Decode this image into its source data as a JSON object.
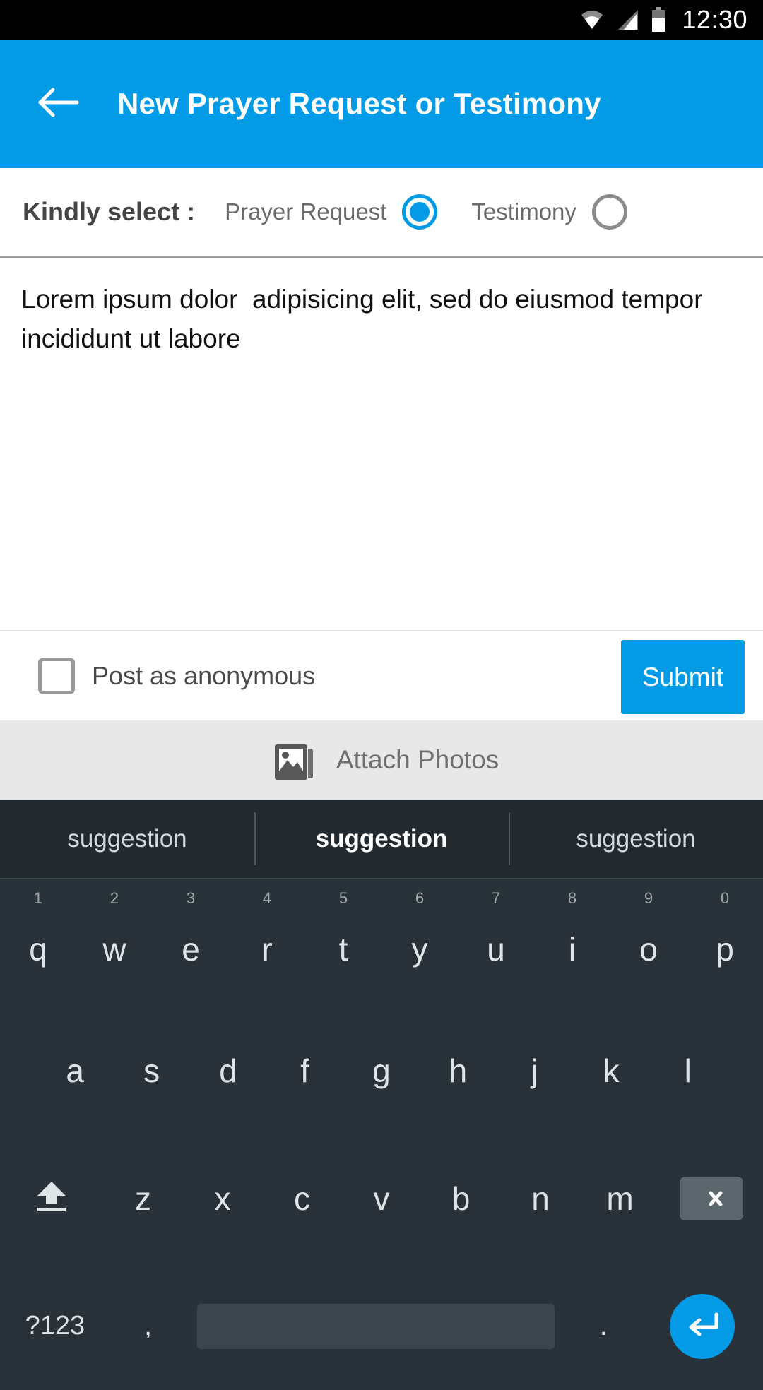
{
  "status_bar": {
    "time": "12:30",
    "icons": [
      "wifi-icon",
      "cell-signal-icon",
      "battery-icon"
    ]
  },
  "app_bar": {
    "back_icon": "arrow-left-icon",
    "title": "New Prayer Request or Testimony",
    "background_color": "#039BE5"
  },
  "select_row": {
    "label": "Kindly select :",
    "options": [
      {
        "label": "Prayer Request",
        "selected": true
      },
      {
        "label": "Testimony",
        "selected": false
      }
    ]
  },
  "compose": {
    "text": "Lorem ipsum dolor  adipisicing elit, sed do eiusmod tempor incididunt ut labore",
    "placeholder": "Lorem ipsum dolor  adipisicing elit, sed do eiusmod tempor incididunt ut labore"
  },
  "action_row": {
    "anonymous_label": "Post as anonymous",
    "anonymous_checked": false,
    "submit_label": "Submit",
    "submit_color": "#039BE5"
  },
  "attach": {
    "icon": "photo-stack-icon",
    "label": "Attach Photos",
    "background_color": "#e8e8e8"
  },
  "keyboard": {
    "suggestions": [
      {
        "text": "suggestion",
        "active": false
      },
      {
        "text": "suggestion",
        "active": true
      },
      {
        "text": "suggestion",
        "active": false
      }
    ],
    "row1": [
      {
        "letter": "q",
        "num": "1"
      },
      {
        "letter": "w",
        "num": "2"
      },
      {
        "letter": "e",
        "num": "3"
      },
      {
        "letter": "r",
        "num": "4"
      },
      {
        "letter": "t",
        "num": "5"
      },
      {
        "letter": "y",
        "num": "6"
      },
      {
        "letter": "u",
        "num": "7"
      },
      {
        "letter": "i",
        "num": "8"
      },
      {
        "letter": "o",
        "num": "9"
      },
      {
        "letter": "p",
        "num": "0"
      }
    ],
    "row2": [
      "a",
      "s",
      "d",
      "f",
      "g",
      "h",
      "j",
      "k",
      "l"
    ],
    "row3": {
      "shift_icon": "shift-up-icon",
      "letters": [
        "z",
        "x",
        "c",
        "v",
        "b",
        "n",
        "m"
      ],
      "backspace_icon": "backspace-icon"
    },
    "row4": {
      "symbols_label": "?123",
      "comma_label": ",",
      "space_label": "",
      "period_label": ".",
      "enter_icon": "enter-return-icon"
    },
    "background_color": "#283238",
    "suggestion_bar_color": "#232a2f"
  }
}
